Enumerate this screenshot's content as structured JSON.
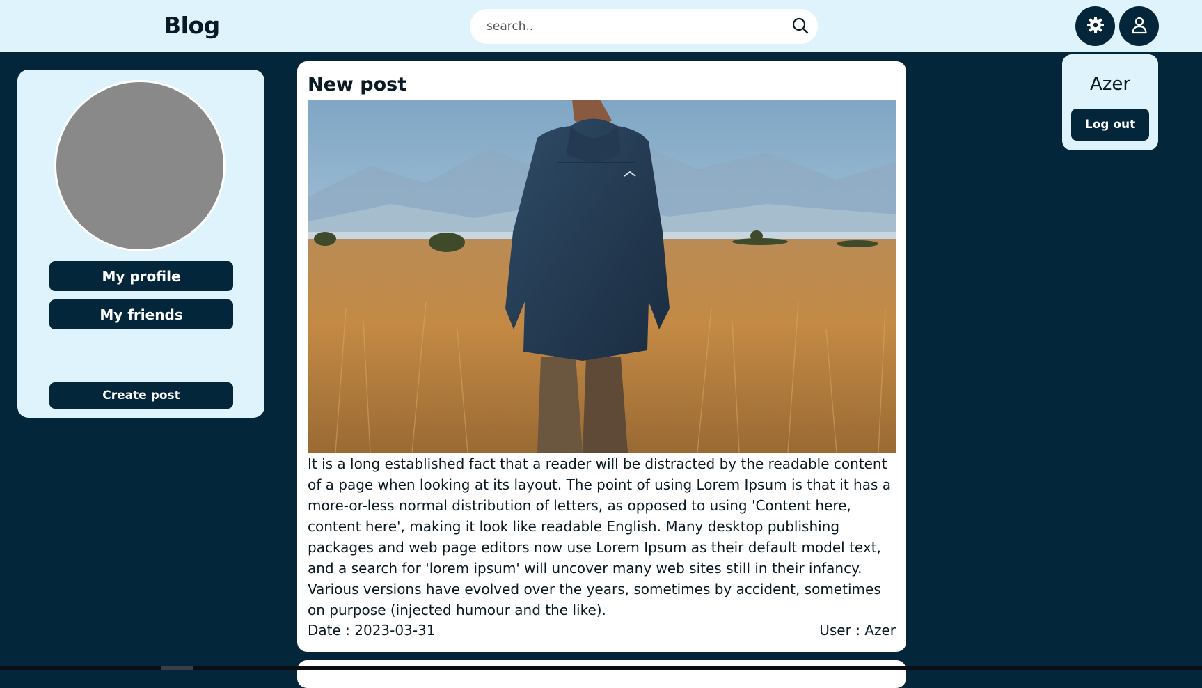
{
  "header": {
    "logo": "Blog",
    "search_placeholder": "search..",
    "icons": {
      "search": "search-icon",
      "settings": "gear-icon",
      "account": "user-icon"
    }
  },
  "sidebar": {
    "avatar": "avatar-placeholder",
    "buttons": {
      "profile": "My profile",
      "friends": "My friends",
      "create": "Create post"
    }
  },
  "post": {
    "title": "New post",
    "image": "man-in-jacket-walking-through-wheat-field",
    "body": "It is a long established fact that a reader will be distracted by the readable content of a page when looking at its layout. The point of using Lorem Ipsum is that it has a more-or-less normal distribution of letters, as opposed to using 'Content here, content here', making it look like readable English. Many desktop publishing packages and web page editors now use Lorem Ipsum as their default model text, and a search for 'lorem ipsum' will uncover many web sites still in their infancy. Various versions have evolved over the years, sometimes by accident, sometimes on purpose (injected humour and the like).",
    "date": "Date : 2023-03-31",
    "user": "User : Azer"
  },
  "user_menu": {
    "name": "Azer",
    "logout": "Log out"
  },
  "colors": {
    "background": "#04263a",
    "panel": "#dff3fc",
    "button": "#04263a",
    "card": "#ffffff",
    "avatar": "#898989"
  }
}
